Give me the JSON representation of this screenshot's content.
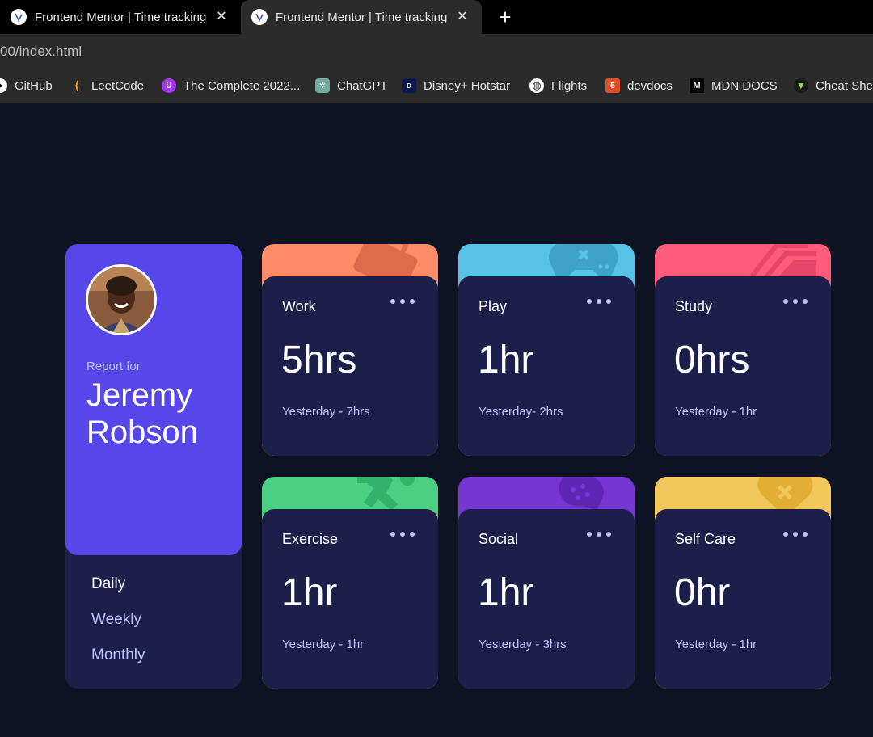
{
  "browser": {
    "tabs": [
      {
        "title": "Frontend Mentor | Time tracking"
      },
      {
        "title": "Frontend Mentor | Time tracking"
      }
    ],
    "url": "00/index.html",
    "bookmarks": [
      {
        "label": "GitHub",
        "icon": "github-icon"
      },
      {
        "label": "LeetCode",
        "icon": "leetcode-icon"
      },
      {
        "label": "The Complete 2022...",
        "icon": "udemy-icon"
      },
      {
        "label": "ChatGPT",
        "icon": "chatgpt-icon"
      },
      {
        "label": "Disney+ Hotstar",
        "icon": "hotstar-icon"
      },
      {
        "label": "Flights",
        "icon": "globe-icon"
      },
      {
        "label": "devdocs",
        "icon": "devdocs-icon"
      },
      {
        "label": "MDN DOCS",
        "icon": "mdn-icon"
      },
      {
        "label": "Cheat Shee",
        "icon": "cheatsheet-icon"
      }
    ]
  },
  "profile": {
    "report_for": "Report for",
    "name_line1": "Jeremy",
    "name_line2": "Robson",
    "periods": [
      "Daily",
      "Weekly",
      "Monthly"
    ],
    "selected_period": "Daily"
  },
  "cards": [
    {
      "category": "Work",
      "hours": "5hrs",
      "previous": "Yesterday - 7hrs",
      "color": "#ff8c66",
      "icon": "briefcase-icon"
    },
    {
      "category": "Play",
      "hours": "1hr",
      "previous": "Yesterday- 2hrs",
      "color": "#56c2e6",
      "icon": "gamepad-icon"
    },
    {
      "category": "Study",
      "hours": "0hrs",
      "previous": "Yesterday - 1hr",
      "color": "#ff5c7c",
      "icon": "books-icon"
    },
    {
      "category": "Exercise",
      "hours": "1hr",
      "previous": "Yesterday - 1hr",
      "color": "#4bcf83",
      "icon": "running-icon"
    },
    {
      "category": "Social",
      "hours": "1hr",
      "previous": "Yesterday - 3hrs",
      "color": "#7536d3",
      "icon": "chat-icon"
    },
    {
      "category": "Self Care",
      "hours": "0hr",
      "previous": "Yesterday - 1hr",
      "color": "#f1c75b",
      "icon": "heart-icon"
    }
  ]
}
